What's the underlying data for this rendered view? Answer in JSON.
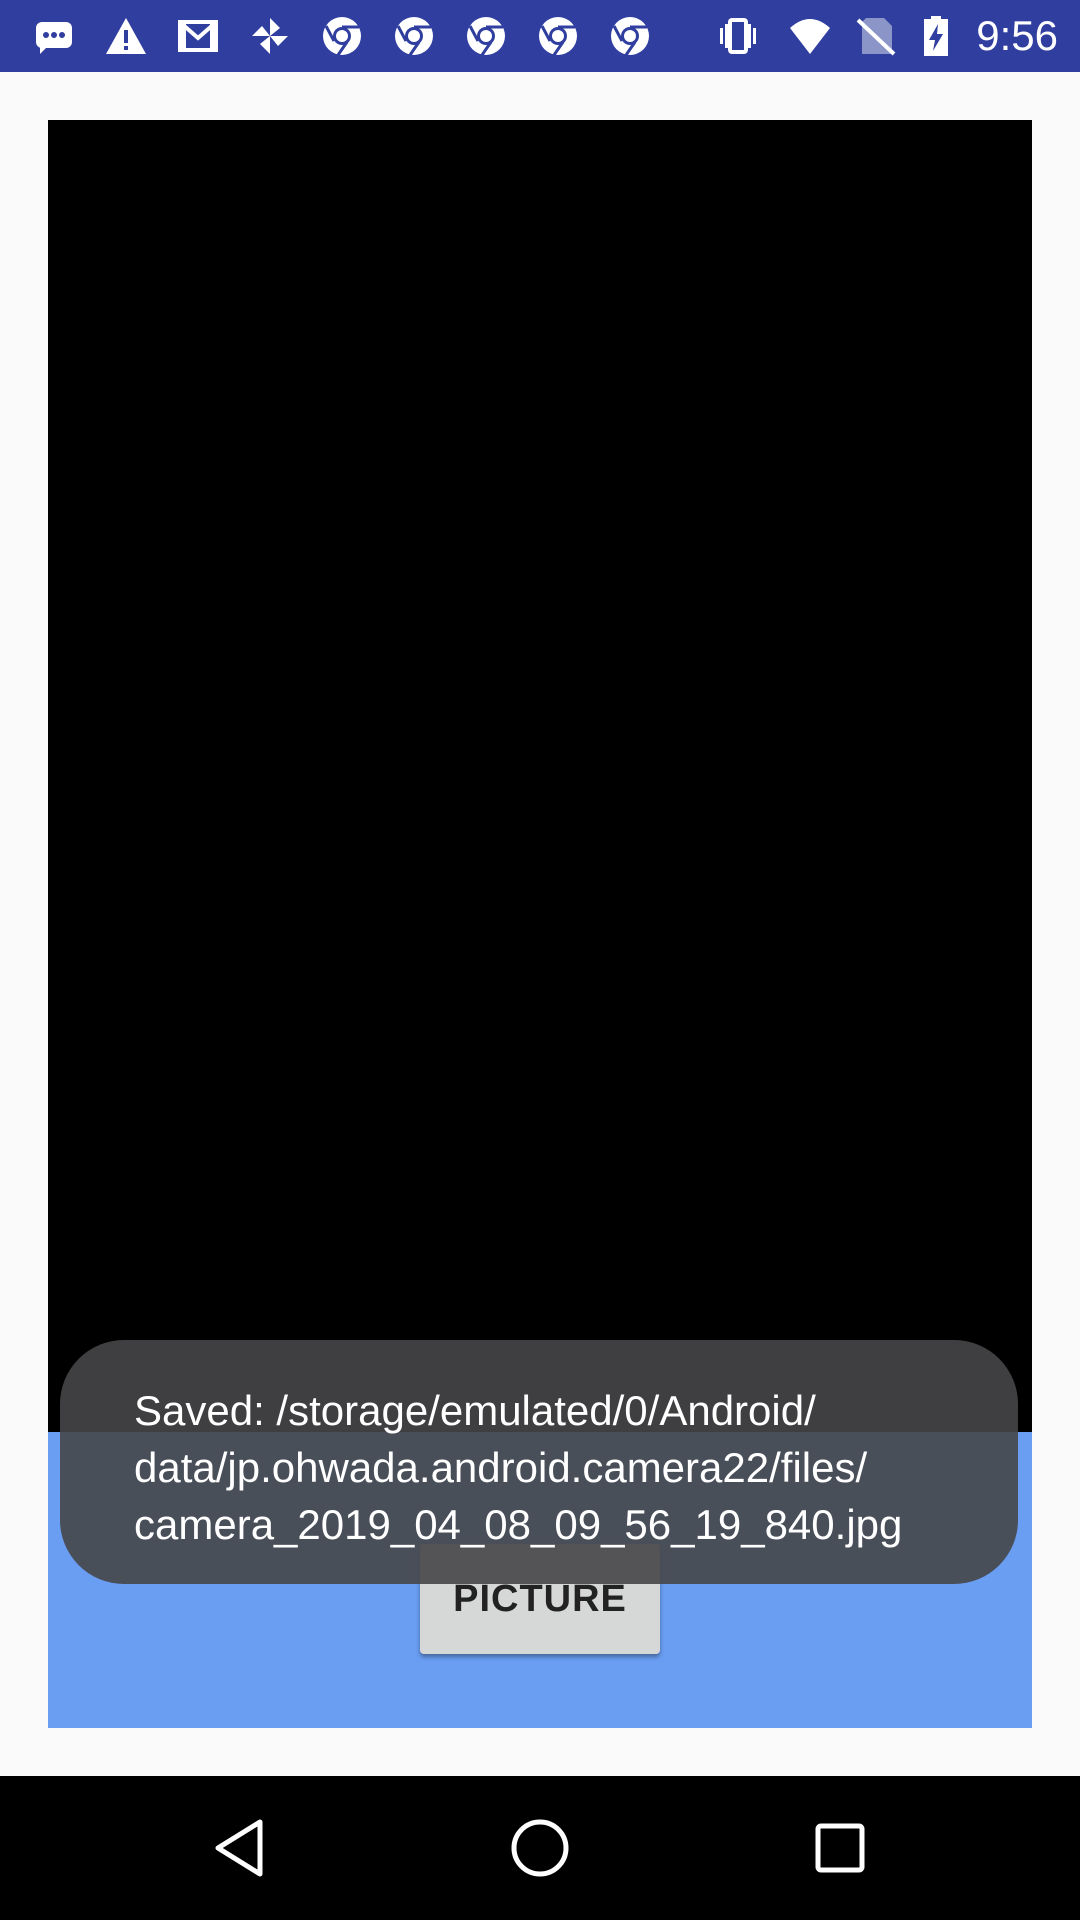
{
  "status_bar": {
    "time": "9:56",
    "background_color": "#303f9f",
    "left_icons": [
      "chat-bubble-icon",
      "warning-icon",
      "gmail-icon",
      "pinwheel-icon",
      "chrome-icon",
      "chrome-icon",
      "chrome-icon",
      "chrome-icon",
      "chrome-icon"
    ],
    "right_icons": [
      "vibrate-icon",
      "wifi-icon",
      "no-sim-icon",
      "battery-charging-icon"
    ]
  },
  "camera": {
    "preview_color": "#000000",
    "panel_color": "#6a9ef2",
    "capture_button_label": "PICTURE"
  },
  "toast": {
    "message": "Saved: /storage/emulated/0/Android/\ndata/jp.ohwada.android.camera22/files/\ncamera_2019_04_08_09_56_19_840.jpg"
  },
  "nav_bar": {
    "buttons": [
      "back-icon",
      "home-icon",
      "recents-icon"
    ]
  }
}
